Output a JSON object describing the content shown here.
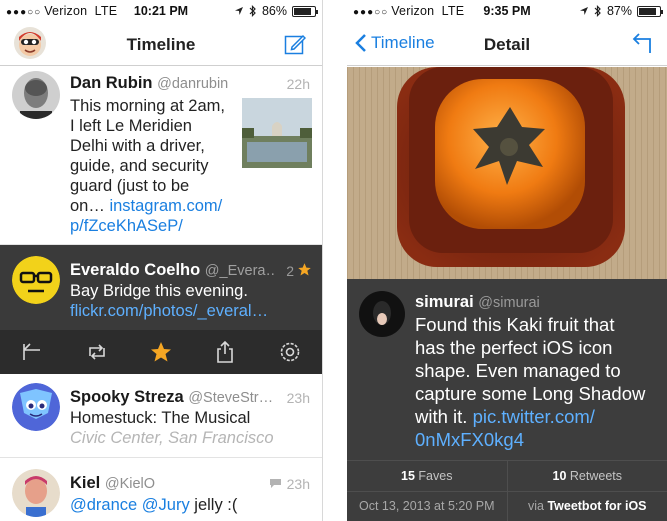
{
  "left": {
    "status": {
      "carrier": "Verizon",
      "network": "LTE",
      "time": "10:21 PM",
      "battery": "86%"
    },
    "nav": {
      "title": "Timeline"
    },
    "tweets": [
      {
        "name": "Dan Rubin",
        "handle": "@danrubin",
        "time": "22h",
        "text_lines": [
          "This morning at 2am,",
          "I left Le Meridien",
          "Delhi with a driver,",
          "guide, and security",
          "guard (just to be"
        ],
        "text_tail": "on… ",
        "link_lines": [
          "instagram.com/",
          "p/fZceKhASeP/"
        ]
      },
      {
        "name": "Everaldo Coelho",
        "handle": "@_Evera…",
        "time": "2",
        "text": "Bay Bridge this evening.",
        "link": "flickr.com/photos/_everal…"
      },
      {
        "name": "Spooky Streza",
        "handle": "@SteveStr…",
        "time": "23h",
        "text": "Homestuck: The Musical",
        "place": "Civic Center, San Francisco"
      },
      {
        "name": "Kiel",
        "handle": "@KielO",
        "time": "23h",
        "mention1": "@drance",
        "mention2": "@Jury",
        "text": " jelly :("
      }
    ],
    "actions": [
      "reply-icon",
      "retweet-icon",
      "star-icon",
      "share-icon",
      "gear-icon"
    ]
  },
  "right": {
    "status": {
      "carrier": "Verizon",
      "network": "LTE",
      "time": "9:35 PM",
      "battery": "87%"
    },
    "nav": {
      "back": "Timeline",
      "title": "Detail"
    },
    "tweet": {
      "name": "simurai",
      "handle": "@simurai",
      "text_lines": [
        "Found this Kaki fruit that",
        "has the perfect iOS icon",
        "shape. Even managed to",
        "capture some Long Shadow",
        "with it. "
      ],
      "link1": "pic.twitter.com/",
      "link2": "0nMxFX0kg4"
    },
    "stats": {
      "faves_count": "15",
      "faves_label": "Faves",
      "retweets_count": "10",
      "retweets_label": "Retweets"
    },
    "meta": {
      "date": "Oct 13, 2013 at 5:20 PM",
      "via_prefix": "via",
      "client": "Tweetbot for iOS"
    }
  },
  "colors": {
    "accent": "#1a7fe0",
    "star": "#f5a623",
    "selected_bg": "#3a3a3a"
  }
}
